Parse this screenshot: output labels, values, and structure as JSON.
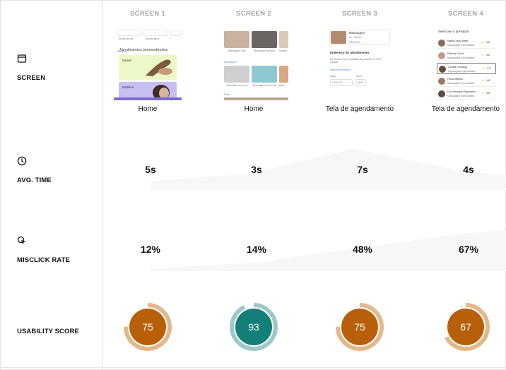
{
  "rows": {
    "screen": "SCREEN",
    "avg_time": "AVG. TIME",
    "misclick_rate": "MISCLICK RATE",
    "usability_score": "USABILITY SCORE"
  },
  "columns": [
    {
      "header": "SCREEN 1",
      "caption": "Home",
      "avg_time": "5s",
      "misclick": "12%",
      "score": "75",
      "score_value": 75,
      "ring_color": "#e2b98c",
      "fill_color": "#b85f0a"
    },
    {
      "header": "SCREEN 2",
      "caption": "Home",
      "avg_time": "3s",
      "misclick": "14%",
      "score": "93",
      "score_value": 93,
      "ring_color": "#9ec9c6",
      "fill_color": "#137f78"
    },
    {
      "header": "SCREEN 3",
      "caption": "Tela de agendamento",
      "avg_time": "7s",
      "misclick": "48%",
      "score": "75",
      "score_value": 75,
      "ring_color": "#e2b98c",
      "fill_color": "#b85f0a"
    },
    {
      "header": "SCREEN 4",
      "caption": "Tela de agendamento",
      "avg_time": "4s",
      "misclick": "67%",
      "score": "67",
      "score_value": 67,
      "ring_color": "#e2b98c",
      "fill_color": "#b85f0a"
    }
  ],
  "thumbs": {
    "s1": {
      "section": "Atendimentos personalizados",
      "card1": "Saúde",
      "card2": "Estética",
      "tab1": "Endereço de trabalho",
      "tab2": "Saúde geral"
    },
    "s2": {
      "items": [
        "Massagem leve",
        "Massagem pedras",
        "Massa"
      ],
      "section1": "Depilação",
      "items2": [
        "Depilação de cera",
        "Depilação de pernas",
        "Depi"
      ],
      "section2": "Pele"
    },
    "s3": {
      "service": "Massagem",
      "duration": "1h · 30min",
      "price": "R$ 30,00",
      "section": "Endereço do atendimento",
      "address": "Av. Endereço do cadastro do usuário, nº 9787, Cidade",
      "change": "Alterar endereço",
      "date_label": "Data",
      "time_label": "Hora",
      "date": "12/07/22",
      "time": "14:00"
    },
    "s4": {
      "title": "Selecione o prestador",
      "people": [
        {
          "name": "Maria Clara Matos",
          "role": "Massagista Especialista",
          "rating": "4.8"
        },
        {
          "name": "Patrícia Souza",
          "role": "Massagista Especialista",
          "rating": "4.8"
        },
        {
          "name": "Camila Camargo",
          "role": "Massagista Especialista",
          "rating": "4.8"
        },
        {
          "name": "Paula Martins",
          "role": "Massagista Especialista",
          "rating": "4.8"
        },
        {
          "name": "Luis Henrique Figueiredo",
          "role": "Massagista Especialista",
          "rating": "4.8"
        }
      ]
    }
  }
}
